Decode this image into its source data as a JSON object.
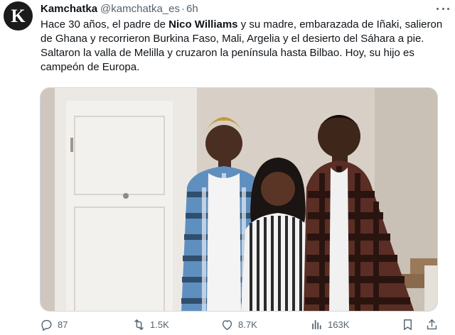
{
  "author": {
    "avatar_letter": "K",
    "display_name": "Kamchatka",
    "handle": "@kamchatka_es",
    "separator": "·",
    "time": "6h"
  },
  "tweet": {
    "text_before": "Hace 30 años, el padre de ",
    "text_bold": "Nico Williams",
    "text_after": " y su madre, embarazada de Iñaki, salieron de Ghana y recorrieron Burkina Faso, Mali, Argelia y el desierto del Sáhara a pie. Saltaron la valla de Melilla y cruzaron la península hasta Bilbao. Hoy, su hijo es campeón de Europa."
  },
  "actions": {
    "replies": "87",
    "retweets": "1.5K",
    "likes": "8.7K",
    "views": "163K"
  },
  "icons": [
    "more-icon",
    "reply-icon",
    "retweet-icon",
    "like-icon",
    "views-icon",
    "bookmark-icon",
    "share-icon"
  ],
  "colors": {
    "text": "#0f1419",
    "secondary": "#536471",
    "avatar_bg": "#1b1b1b"
  }
}
